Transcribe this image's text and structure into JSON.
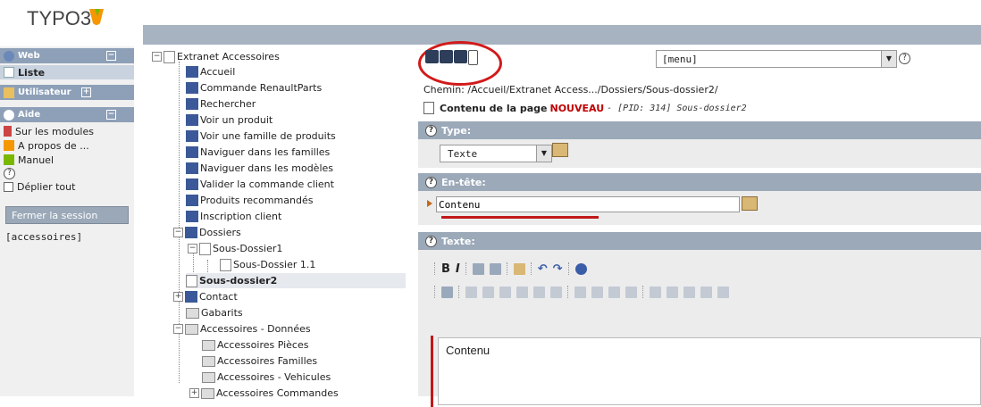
{
  "app": {
    "logo_text": "TYPO3"
  },
  "modules": {
    "web": {
      "label": "Web",
      "toggle": "−"
    },
    "liste": "Liste",
    "utilisateur": {
      "label": "Utilisateur",
      "toggle": "+"
    },
    "aide": {
      "label": "Aide",
      "toggle": "−"
    },
    "help_items": [
      "Sur les modules",
      "A propos de ...",
      "Manuel"
    ],
    "deplier": "Déplier tout",
    "logout": "Fermer la session",
    "user": "[accessoires]"
  },
  "tree": {
    "root": "Extranet Accessoires",
    "pages": [
      "Accueil",
      "Commande RenaultParts",
      "Rechercher",
      "Voir un produit",
      "Voir une famille de produits",
      "Naviguer dans les familles",
      "Naviguer dans les modèles",
      "Valider la commande client",
      "Produits recommandés",
      "Inscription client"
    ],
    "dossiers": "Dossiers",
    "sous_dossier1": "Sous-Dossier1",
    "sous_dossier_1_1": "Sous-Dossier 1.1",
    "sous_dossier2": "Sous-dossier2",
    "contact": "Contact",
    "gabarits": "Gabarits",
    "acc_donnees": "Accessoires - Données",
    "acc_children": [
      "Accessoires Pièces",
      "Accessoires Familles",
      "Accessoires - Vehicules",
      "Accessoires Commandes"
    ]
  },
  "form": {
    "menu_select": "[menu]",
    "path": "Chemin: /Accueil/Extranet Access.../Dossiers/Sous-dossier2/",
    "page_info_prefix": "Contenu de la page",
    "page_info_new": "NOUVEAU",
    "page_info_suffix": "- [PID: 314] Sous-dossier2",
    "type_label": "Type:",
    "type_value": "Texte",
    "header_label": "En-tête:",
    "header_value": "Contenu",
    "text_label": "Texte:",
    "text_value": "Contenu"
  },
  "colors": {
    "accent_red": "#c01818",
    "section_header": "#9ba9b9",
    "module_header": "#8ea0b8"
  }
}
